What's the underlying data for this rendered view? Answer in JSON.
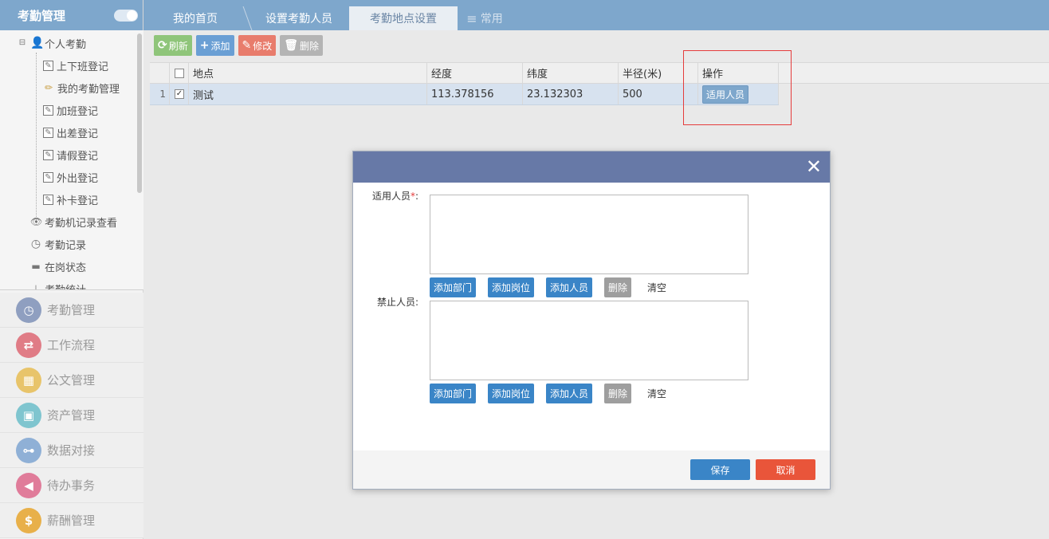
{
  "sidebar": {
    "title": "考勤管理",
    "tree": {
      "root_label": "个人考勤",
      "items": [
        {
          "label": "上下班登记",
          "icon": "edit-box-icon"
        },
        {
          "label": "我的考勤管理",
          "icon": "pencil-icon"
        },
        {
          "label": "加班登记",
          "icon": "edit-box-icon"
        },
        {
          "label": "出差登记",
          "icon": "edit-box-icon"
        },
        {
          "label": "请假登记",
          "icon": "edit-box-icon"
        },
        {
          "label": "外出登记",
          "icon": "edit-box-icon"
        },
        {
          "label": "补卡登记",
          "icon": "edit-box-icon"
        }
      ],
      "extra": [
        {
          "label": "考勤机记录查看",
          "icon": "eye-icon"
        },
        {
          "label": "考勤记录",
          "icon": "clock-icon"
        },
        {
          "label": "在岗状态",
          "icon": "card-icon"
        },
        {
          "label": "考勤统计",
          "icon": "chart-icon"
        }
      ]
    },
    "modules": [
      {
        "label": "考勤管理",
        "icon": "clock-icon",
        "color": "#8f9fc0"
      },
      {
        "label": "工作流程",
        "icon": "flow-icon",
        "color": "#e07c86"
      },
      {
        "label": "公文管理",
        "icon": "document-icon",
        "color": "#e8c46a"
      },
      {
        "label": "资产管理",
        "icon": "briefcase-icon",
        "color": "#7fc5cf"
      },
      {
        "label": "数据对接",
        "icon": "plug-icon",
        "color": "#8fb0d6"
      },
      {
        "label": "待办事务",
        "icon": "speaker-icon",
        "color": "#e07c9a"
      },
      {
        "label": "薪酬管理",
        "icon": "money-bag-icon",
        "color": "#e8b04a"
      }
    ]
  },
  "tabs": [
    {
      "label": "我的首页"
    },
    {
      "label": "设置考勤人员"
    },
    {
      "label": "考勤地点设置"
    },
    {
      "label": "常用"
    }
  ],
  "toolbar": {
    "refresh": "刷新",
    "add": "添加",
    "edit": "修改",
    "delete": "删除"
  },
  "grid": {
    "columns": [
      "地点",
      "经度",
      "纬度",
      "半径(米)",
      "操作"
    ],
    "rows": [
      {
        "index": "1",
        "checked": true,
        "location": "测试",
        "longitude": "113.378156",
        "latitude": "23.132303",
        "radius": "500",
        "action": "适用人员"
      }
    ]
  },
  "modal": {
    "close": "✕",
    "apply_label": "适用人员",
    "apply_required": "*",
    "apply_colon": ":",
    "forbid_label": "禁止人员:",
    "apply_value": "",
    "forbid_value": "",
    "btn_add_dept": "添加部门",
    "btn_add_post": "添加岗位",
    "btn_add_user": "添加人员",
    "btn_delete": "删除",
    "btn_clear": "清空",
    "save": "保存",
    "cancel": "取消"
  },
  "colors": {
    "header_blue": "#7ea7cc",
    "modal_header": "#6779a7",
    "primary_button": "#3a85c7",
    "cancel_button": "#e9553a",
    "refresh_button": "#8fc57a",
    "add_button": "#6a9fd4",
    "edit_button": "#e87c6c",
    "delete_button": "#b4b4b4"
  }
}
